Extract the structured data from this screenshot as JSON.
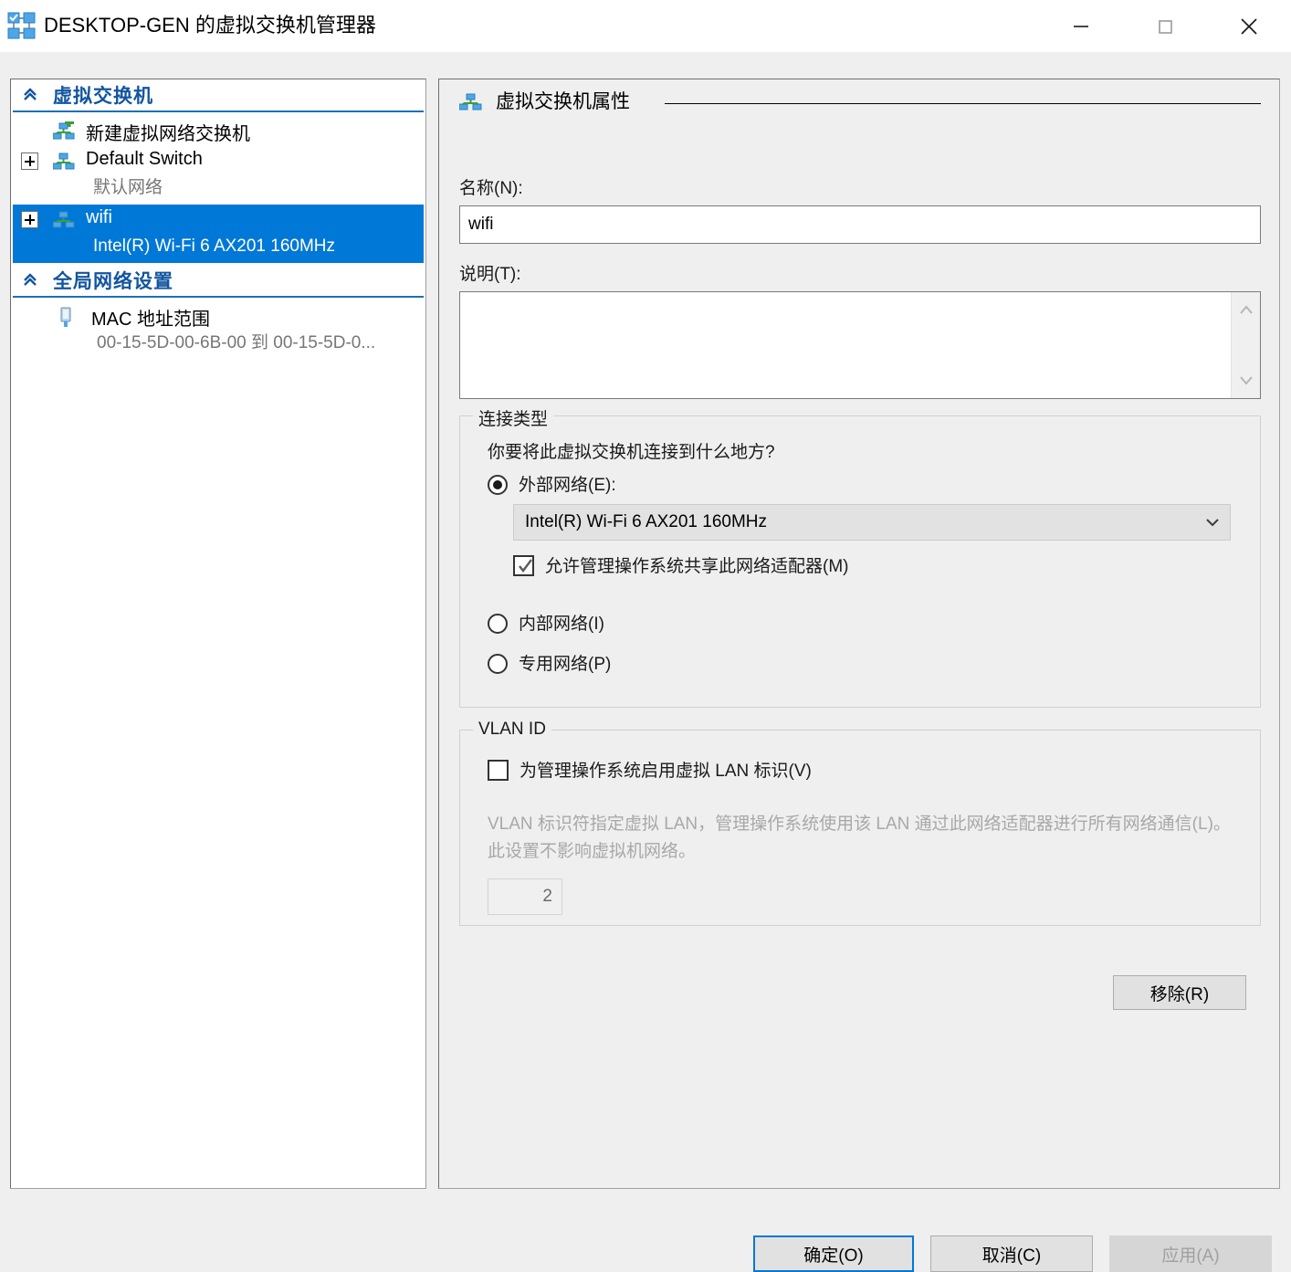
{
  "window": {
    "title": "DESKTOP-GEN 的虚拟交换机管理器",
    "app_icon": "virtual-switch-manager-icon",
    "minimize_label": "最小化",
    "maximize_label": "最大化",
    "close_label": "关闭"
  },
  "tree": {
    "sections": [
      {
        "label": "虚拟交换机",
        "chevron": "chevron-double-up-icon",
        "items": [
          {
            "label": "新建虚拟网络交换机",
            "icon": "new-virtual-switch-icon",
            "has_expander": false,
            "sub": "",
            "selected": false
          },
          {
            "label": "Default Switch",
            "icon": "virtual-switch-icon",
            "has_expander": true,
            "expander": "plus-icon",
            "sub": "默认网络",
            "selected": false
          },
          {
            "label": "wifi",
            "icon": "virtual-switch-icon",
            "has_expander": true,
            "expander": "plus-icon",
            "sub": "Intel(R) Wi-Fi 6 AX201 160MHz",
            "selected": true
          }
        ]
      },
      {
        "label": "全局网络设置",
        "chevron": "chevron-double-up-icon",
        "items": [
          {
            "label": "MAC 地址范围",
            "icon": "mac-address-icon",
            "has_expander": false,
            "sub": "00-15-5D-00-6B-00 到 00-15-5D-0...",
            "selected": false
          }
        ]
      }
    ]
  },
  "detail": {
    "header": {
      "icon": "virtual-switch-icon",
      "title": "虚拟交换机属性"
    },
    "name": {
      "label": "名称(N):",
      "value": "wifi",
      "placeholder": ""
    },
    "description": {
      "label": "说明(T):",
      "value": "",
      "placeholder": "",
      "scroll_up_icon": "chevron-up-icon",
      "scroll_down_icon": "chevron-down-icon"
    },
    "connection_type": {
      "group_title": "连接类型",
      "question": "你要将此虚拟交换机连接到什么地方?",
      "options": [
        {
          "label": "外部网络(E):",
          "checked": true
        },
        {
          "label": "内部网络(I)",
          "checked": false
        },
        {
          "label": "专用网络(P)",
          "checked": false
        }
      ],
      "adapter": {
        "selected": "Intel(R) Wi-Fi 6 AX201 160MHz",
        "arrow_icon": "chevron-down-icon",
        "options": [
          "Intel(R) Wi-Fi 6 AX201 160MHz"
        ]
      },
      "share_checkbox": {
        "label": "允许管理操作系统共享此网络适配器(M)",
        "checked": true,
        "icon": "check-icon"
      }
    },
    "vlan": {
      "group_title": "VLAN ID",
      "enable_checkbox": {
        "label": "为管理操作系统启用虚拟 LAN 标识(V)",
        "checked": false
      },
      "description": "VLAN 标识符指定虚拟 LAN，管理操作系统使用该 LAN 通过此网络适配器进行所有网络通信(L)。此设置不影响虚拟机网络。",
      "id_value": "2",
      "id_disabled": true
    },
    "remove_label": "移除(R)"
  },
  "footer": {
    "ok_label": "确定(O)",
    "cancel_label": "取消(C)",
    "apply_label": "应用(A)",
    "apply_disabled": true
  },
  "colors": {
    "selection_blue": "#0078d7",
    "section_header_blue": "#1255a0",
    "window_bg": "#efefef",
    "disabled_text": "#a8a8a8"
  }
}
